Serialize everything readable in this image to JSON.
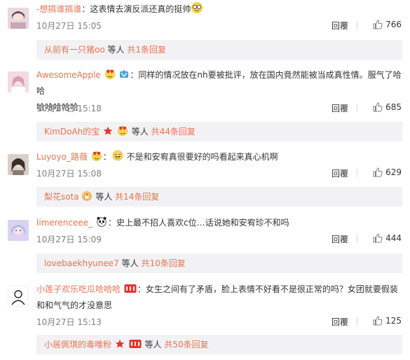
{
  "colors": {
    "link": "#eb7350",
    "meta": "#808080",
    "sub_bg": "#f2f2f5"
  },
  "ui": {
    "reply_label": "回覆",
    "others_label": "等人"
  },
  "comments": [
    {
      "username": "-想搞谁搞谁",
      "colon": "：",
      "text": "这表情去演反派还真的挺帅",
      "time": "10月27日 15:05",
      "likes": "766",
      "sub_user": "从前有一只猪oo",
      "sub_more": "共1条回复"
    },
    {
      "username": "AwesomeApple",
      "colon": "：",
      "text_line1": "同样的情况放在nh要被批评，放在国内竟然能被当成真性情。服气了哈哈",
      "text_line2": "哈哈哈哈哈",
      "time": "10月27日 15:18",
      "likes": "685",
      "sub_user": "KimDoAh的宝",
      "sub_more": "共44条回复"
    },
    {
      "username": "Luyoyo_路薇",
      "colon": "：",
      "text": "不是和安宥真很要好的吗看起来真心机啊",
      "time": "10月27日 15:08",
      "likes": "629",
      "sub_user": "梨花sota",
      "sub_more": "共14条回复"
    },
    {
      "username": "limerenceee_",
      "colon": "：",
      "text": "史上最不招人喜欢c位…话说她和安宥珍不和吗",
      "time": "10月27日 15:09",
      "likes": "444",
      "sub_user": "lovebaekhyunee7",
      "sub_more": "共10条回复"
    },
    {
      "username": "小莲子欢乐吃瓜哈哈哈",
      "colon": "：",
      "text_line1": "女生之间有了矛盾，脸上表情不好看不是很正常的吗？女团就要假装",
      "text_line2": "和和气气的才没意思",
      "time": "10月27日 15:13",
      "likes": "125",
      "sub_user": "小居佩琪的毒唯粉",
      "sub_more": "共50条回复"
    }
  ]
}
